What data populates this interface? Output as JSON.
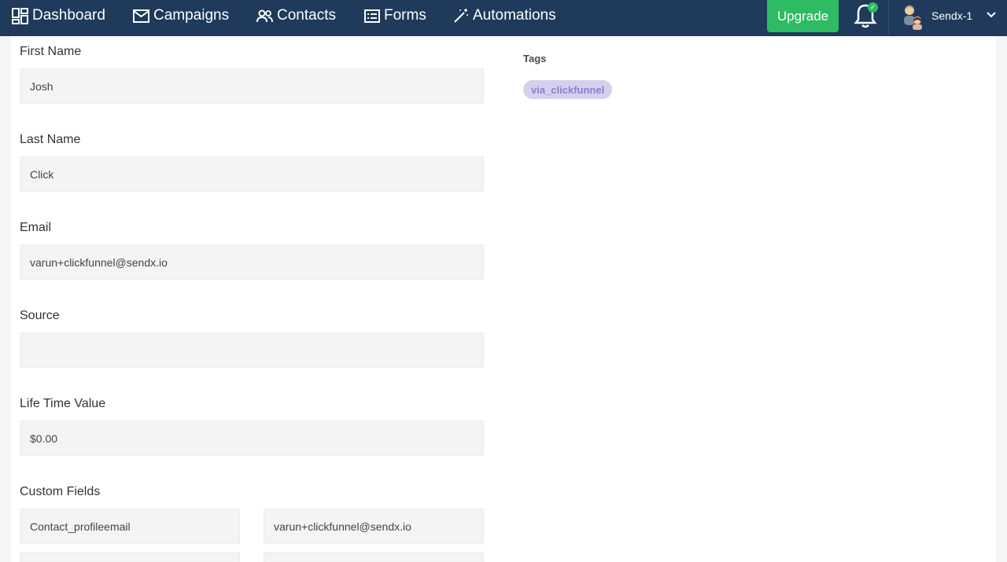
{
  "nav": {
    "items": [
      {
        "label": "Dashboard",
        "icon": "dashboard-icon"
      },
      {
        "label": "Campaigns",
        "icon": "mail-icon"
      },
      {
        "label": "Contacts",
        "icon": "people-icon"
      },
      {
        "label": "Forms",
        "icon": "form-icon"
      },
      {
        "label": "Automations",
        "icon": "magic-wand-icon"
      }
    ],
    "upgrade_label": "Upgrade",
    "notification_badge": "✓",
    "account_name": "Sendx-1"
  },
  "form": {
    "first_name": {
      "label": "First Name",
      "value": "Josh"
    },
    "last_name": {
      "label": "Last Name",
      "value": "Click"
    },
    "email": {
      "label": "Email",
      "value": "varun+clickfunnel@sendx.io"
    },
    "source": {
      "label": "Source",
      "value": ""
    },
    "lifetime_value": {
      "label": "Life Time Value",
      "value": "$0.00"
    },
    "custom_fields": {
      "label": "Custom Fields",
      "rows": [
        {
          "name": "Contact_profileemail",
          "value": "varun+clickfunnel@sendx.io"
        },
        {
          "name": "",
          "value": ""
        }
      ]
    }
  },
  "tags": {
    "title": "Tags",
    "items": [
      "via_clickfunnel"
    ]
  },
  "colors": {
    "nav_bg": "#1f3a5a",
    "upgrade": "#2dbb63",
    "tag_bg": "#d4d1ef",
    "tag_text": "#8a7fd0"
  }
}
